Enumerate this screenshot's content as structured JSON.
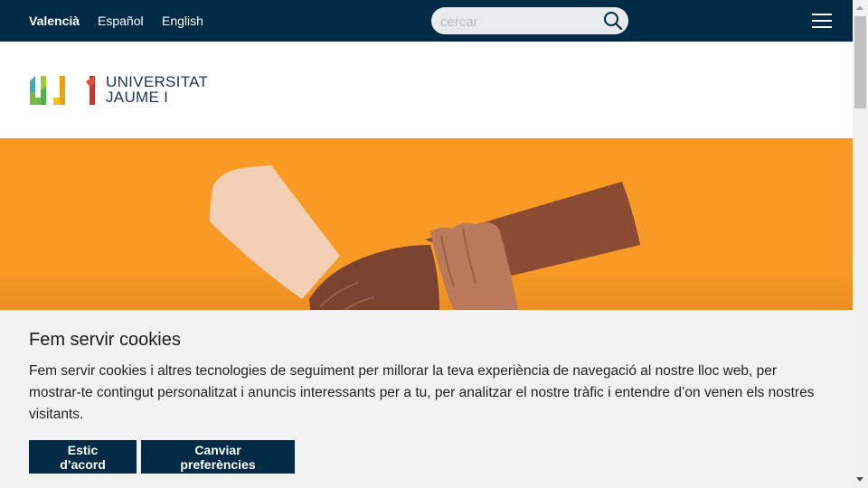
{
  "topbar": {
    "languages": [
      {
        "label": "Valencià",
        "active": true
      },
      {
        "label": "Español",
        "active": false
      },
      {
        "label": "English",
        "active": false
      }
    ],
    "search": {
      "placeholder": "cercar",
      "icon": "search-icon"
    },
    "menu_icon": "hamburger-menu-icon"
  },
  "header": {
    "logo": {
      "mark": "UJI",
      "line1": "UNIVERSITAT",
      "line2": "JAUME I"
    }
  },
  "cookie_banner": {
    "title": "Fem servir cookies",
    "text": "Fem servir cookies i altres tecnologies de seguiment per millorar la teva experiència de navegació al nostre lloc web, per mostrar-te contingut personalitzat i anuncis interessants per a tu, per analitzar el nostre tràfic i entendre d’on venen els nostres visitants.",
    "accept_label": "Estic d’acord",
    "preferences_label": "Canviar preferències"
  },
  "colors": {
    "navy": "#002a45",
    "hero_orange": "#f89a25",
    "banner_bg": "#f2f2f2"
  }
}
